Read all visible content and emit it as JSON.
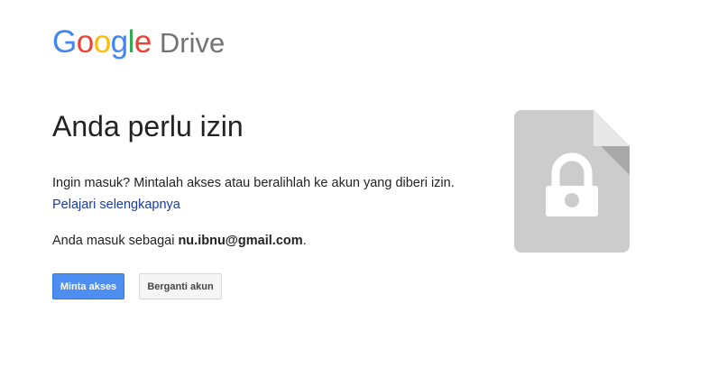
{
  "logo": {
    "google_letters": [
      {
        "char": "G",
        "color": "#4285F4"
      },
      {
        "char": "o",
        "color": "#EA4335"
      },
      {
        "char": "o",
        "color": "#FBBC05"
      },
      {
        "char": "g",
        "color": "#4285F4"
      },
      {
        "char": "l",
        "color": "#34A853"
      },
      {
        "char": "e",
        "color": "#EA4335"
      }
    ],
    "product": "Drive"
  },
  "main": {
    "title": "Anda perlu izin",
    "message": "Ingin masuk? Mintalah akses atau beralihlah ke akun yang diberi izin.",
    "learn_more": "Pelajari selengkapnya",
    "signed_in_prefix": "Anda masuk sebagai ",
    "email": "nu.ibnu@gmail.com",
    "signed_in_suffix": "."
  },
  "buttons": {
    "request_access": "Minta akses",
    "switch_account": "Berganti akun"
  },
  "illustration": {
    "icon": "locked-file-icon",
    "colors": {
      "body": "#cccccc",
      "fold": "#a9a9a9",
      "fold_light": "#e8e8e8",
      "lock": "#ffffff"
    }
  },
  "colors": {
    "primary_button": "#4d8ef0",
    "link": "#1a3ca6",
    "text": "#222222"
  }
}
